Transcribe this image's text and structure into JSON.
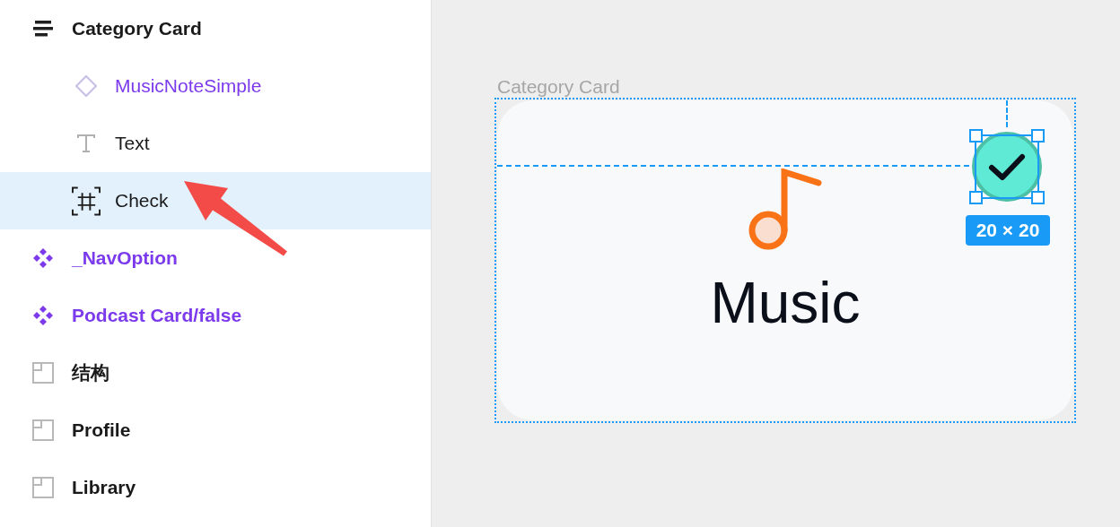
{
  "layers": [
    {
      "kind": "stack",
      "label": "Category Card",
      "selected": false,
      "children": [
        {
          "kind": "component",
          "label": "MusicNoteSimple",
          "selected": false
        },
        {
          "kind": "text",
          "label": "Text",
          "selected": false
        },
        {
          "kind": "frame",
          "label": "Check",
          "selected": true
        }
      ]
    },
    {
      "kind": "instance",
      "label": "_NavOption",
      "selected": false
    },
    {
      "kind": "instance",
      "label": "Podcast Card/false",
      "selected": false
    },
    {
      "kind": "board",
      "label": "结构",
      "selected": false
    },
    {
      "kind": "board",
      "label": "Profile",
      "selected": false
    },
    {
      "kind": "board",
      "label": "Library",
      "selected": false
    }
  ],
  "canvas": {
    "frame_label": "Category Card",
    "card": {
      "title": "Music",
      "checked": true
    },
    "size_badge": "20 × 20"
  }
}
